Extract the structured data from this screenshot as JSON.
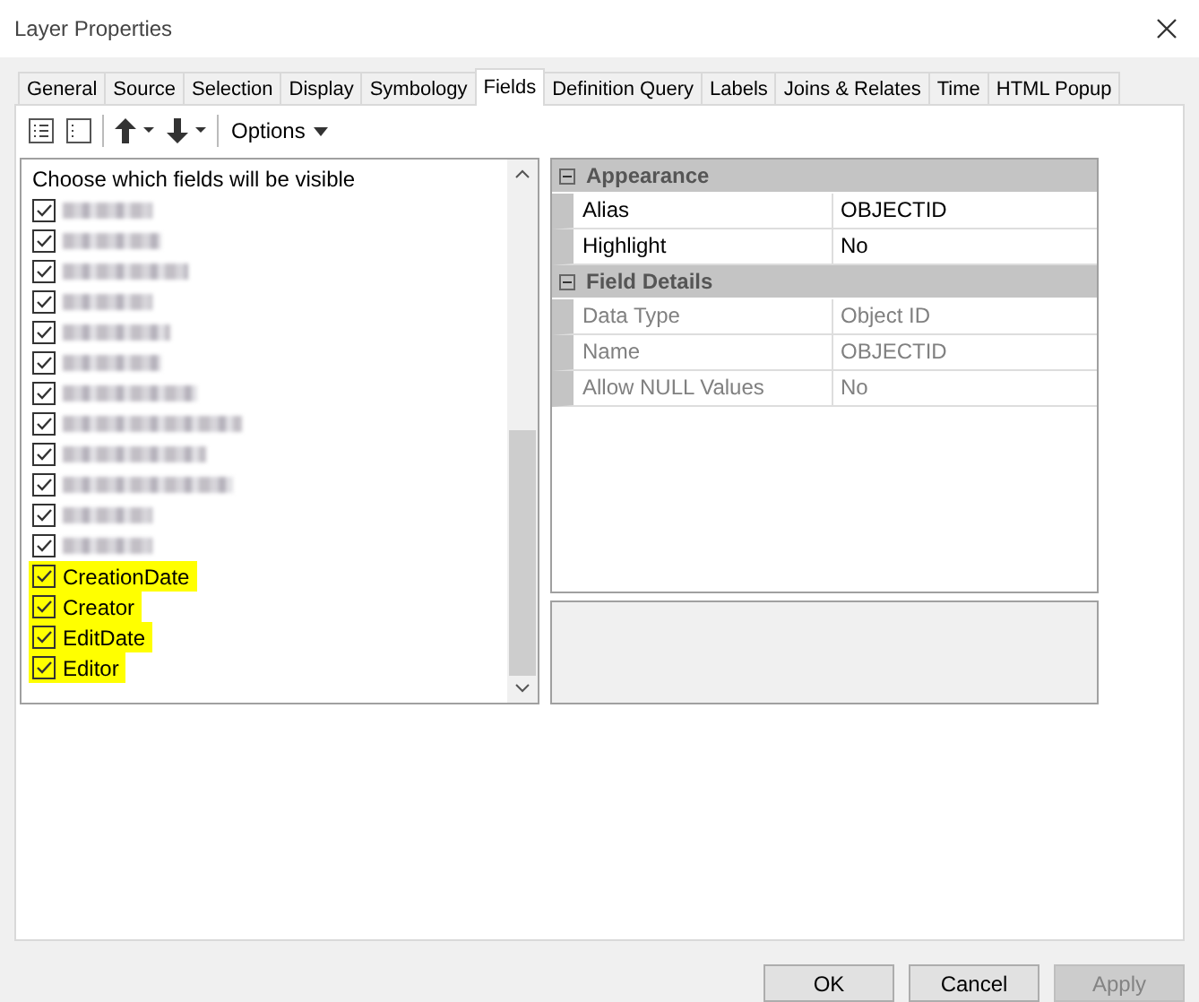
{
  "window": {
    "title": "Layer Properties"
  },
  "tabs": [
    {
      "label": "General",
      "selected": false
    },
    {
      "label": "Source",
      "selected": false
    },
    {
      "label": "Selection",
      "selected": false
    },
    {
      "label": "Display",
      "selected": false
    },
    {
      "label": "Symbology",
      "selected": false
    },
    {
      "label": "Fields",
      "selected": true
    },
    {
      "label": "Definition Query",
      "selected": false
    },
    {
      "label": "Labels",
      "selected": false
    },
    {
      "label": "Joins & Relates",
      "selected": false
    },
    {
      "label": "Time",
      "selected": false
    },
    {
      "label": "HTML Popup",
      "selected": false
    }
  ],
  "toolbar": {
    "options_label": "Options"
  },
  "field_list": {
    "heading": "Choose which fields will be visible",
    "items": [
      {
        "kind": "blurred",
        "checked": true,
        "highlighted": false
      },
      {
        "kind": "blurred",
        "checked": true,
        "highlighted": false
      },
      {
        "kind": "blurred",
        "checked": true,
        "highlighted": false
      },
      {
        "kind": "blurred",
        "checked": true,
        "highlighted": false
      },
      {
        "kind": "blurred",
        "checked": true,
        "highlighted": false
      },
      {
        "kind": "blurred",
        "checked": true,
        "highlighted": false
      },
      {
        "kind": "blurred",
        "checked": true,
        "highlighted": false
      },
      {
        "kind": "blurred",
        "checked": true,
        "highlighted": false
      },
      {
        "kind": "blurred",
        "checked": true,
        "highlighted": false
      },
      {
        "kind": "blurred",
        "checked": true,
        "highlighted": false
      },
      {
        "kind": "blurred",
        "checked": true,
        "highlighted": false
      },
      {
        "kind": "blurred",
        "checked": true,
        "highlighted": false
      },
      {
        "kind": "text",
        "label": "CreationDate",
        "checked": true,
        "highlighted": true
      },
      {
        "kind": "text",
        "label": "Creator",
        "checked": true,
        "highlighted": true
      },
      {
        "kind": "text",
        "label": "EditDate",
        "checked": true,
        "highlighted": true
      },
      {
        "kind": "text",
        "label": "Editor",
        "checked": true,
        "highlighted": true
      }
    ]
  },
  "property_grid": {
    "sections": [
      {
        "title": "Appearance",
        "expanded": true,
        "rows": [
          {
            "name": "Alias",
            "value": "OBJECTID",
            "readonly": false
          },
          {
            "name": "Highlight",
            "value": "No",
            "readonly": false
          }
        ]
      },
      {
        "title": "Field Details",
        "expanded": true,
        "rows": [
          {
            "name": "Data Type",
            "value": "Object ID",
            "readonly": true
          },
          {
            "name": "Name",
            "value": "OBJECTID",
            "readonly": true
          },
          {
            "name": "Allow NULL Values",
            "value": "No",
            "readonly": true
          }
        ]
      }
    ]
  },
  "buttons": [
    {
      "label": "OK",
      "disabled": false
    },
    {
      "label": "Cancel",
      "disabled": false
    },
    {
      "label": "Apply",
      "disabled": true
    }
  ]
}
